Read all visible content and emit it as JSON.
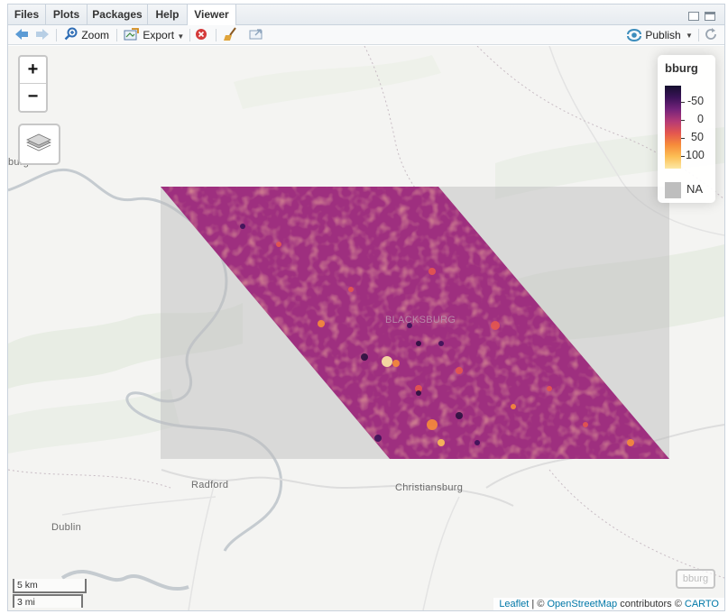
{
  "tabs": [
    {
      "label": "Files",
      "active": false
    },
    {
      "label": "Plots",
      "active": false
    },
    {
      "label": "Packages",
      "active": false
    },
    {
      "label": "Help",
      "active": false
    },
    {
      "label": "Viewer",
      "active": true
    }
  ],
  "toolbar": {
    "zoom_label": "Zoom",
    "export_label": "Export",
    "publish_label": "Publish",
    "icons": [
      "back-arrow-icon",
      "forward-arrow-icon",
      "zoom-icon",
      "export-icon",
      "remove-icon",
      "clear-broom-icon",
      "show-in-window-icon",
      "publish-icon",
      "refresh-icon"
    ]
  },
  "map": {
    "zoom_in": "+",
    "zoom_out": "−",
    "places": {
      "left_edge": "burg",
      "radford": "Radford",
      "dublin": "Dublin",
      "christiansburg": "Christiansburg",
      "blacksburg": "BLACKSBURG"
    },
    "legend": {
      "title": "bburg",
      "labels": [
        "-50",
        "0",
        "50",
        "100"
      ],
      "na_label": "NA",
      "colors": [
        "#150f2e",
        "#74237a",
        "#b43a76",
        "#e4564f",
        "#fcbf55",
        "#fce8a4"
      ],
      "na_color": "#bebebe"
    },
    "scale": {
      "metric": "5 km",
      "imperial": "3 mi"
    },
    "layer_badge": "bburg",
    "attribution": {
      "leaflet": "Leaflet",
      "sep1": " | © ",
      "osm": "OpenStreetMap",
      "mid": " contributors © ",
      "carto": "CARTO"
    }
  },
  "raster": {
    "legend_range": [
      -50,
      120
    ],
    "base_color": "#9e2f7f",
    "na_color": "#bebebe"
  }
}
